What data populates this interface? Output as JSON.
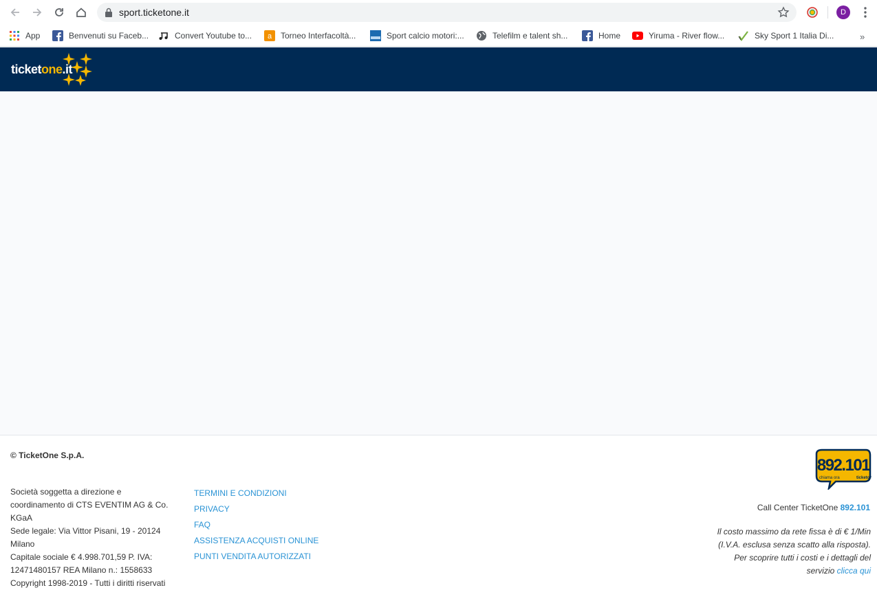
{
  "browser": {
    "url": "sport.ticketone.it",
    "profile_initial": "D",
    "bookmarks": [
      {
        "label": "App",
        "icon": "apps-grid-icon"
      },
      {
        "label": "Benvenuti su Faceb...",
        "icon": "facebook-icon"
      },
      {
        "label": "Convert Youtube to...",
        "icon": "music-note-icon"
      },
      {
        "label": "Torneo Interfacoltà...",
        "icon": "aruba-icon"
      },
      {
        "label": "Sport calcio motori:...",
        "icon": "sport-site-icon"
      },
      {
        "label": "Telefilm e talent sh...",
        "icon": "globe-icon"
      },
      {
        "label": "Home",
        "icon": "facebook-icon"
      },
      {
        "label": "Yiruma - River flow...",
        "icon": "youtube-icon"
      },
      {
        "label": "Sky Sport 1 Italia Di...",
        "icon": "sky-sport-icon"
      }
    ],
    "more_bookmarks": "»"
  },
  "site": {
    "logo_text_a": "ticket",
    "logo_text_b": "one",
    "logo_text_c": ".it",
    "colors": {
      "header_bg": "#002a54",
      "accent": "#f5b700",
      "link": "#2a93d5"
    }
  },
  "footer": {
    "copyright": "© TicketOne S.p.A.",
    "legal_lines": [
      "Società soggetta a direzione e",
      "coordinamento di CTS EVENTIM AG & Co.",
      "KGaA",
      "Sede legale: Via Vittor Pisani, 19 - 20124",
      "Milano",
      "Capitale sociale € 4.998.701,59 P. IVA:",
      "12471480157 REA Milano n.: 1558633",
      "Copyright 1998-2019 - Tutti i diritti riservati"
    ],
    "links": [
      "TERMINI E CONDIZIONI",
      "PRIVACY",
      "FAQ",
      "ASSISTENZA ACQUISTI ONLINE",
      "PUNTI VENDITA AUTORIZZATI"
    ],
    "cc_logo_number": "892.101",
    "cc_logo_sub_a": "chiama ora",
    "cc_logo_sub_b": "ticketone",
    "callcenter_label": "Call Center TicketOne ",
    "callcenter_number": "892.101",
    "costs_lines": [
      "Il costo massimo da rete fissa è di € 1/Min",
      "(I.V.A. esclusa senza scatto alla risposta).",
      "Per scoprire tutti i costi e i dettagli del"
    ],
    "costs_last_prefix": "servizio ",
    "costs_link": "clicca qui"
  }
}
